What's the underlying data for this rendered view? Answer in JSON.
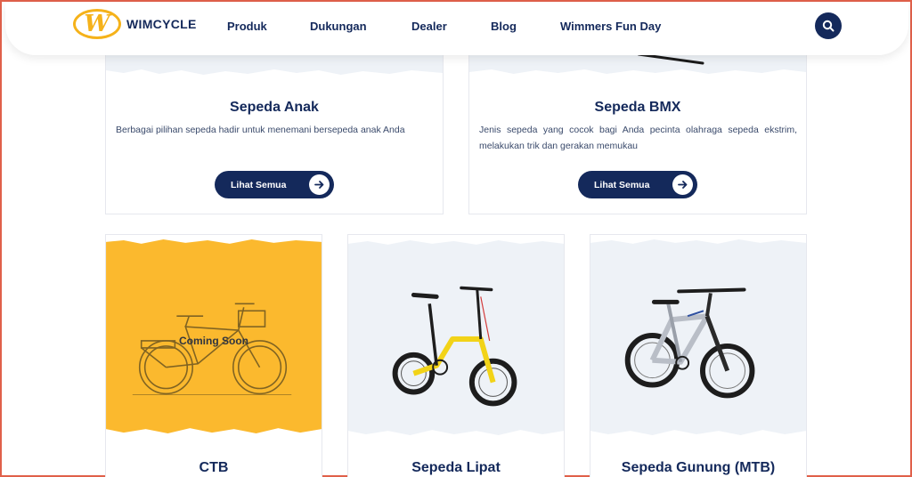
{
  "header": {
    "logo_text": "WIMCYCLE",
    "logo_letter": "W",
    "nav": [
      "Produk",
      "Dukungan",
      "Dealer",
      "Blog",
      "Wimmers Fun Day"
    ]
  },
  "cards_top": [
    {
      "title": "Sepeda Anak",
      "desc": "Berbagai pilihan sepeda hadir untuk menemani bersepeda anak Anda",
      "button": "Lihat Semua"
    },
    {
      "title": "Sepeda BMX",
      "desc": "Jenis sepeda yang cocok bagi Anda pecinta olahraga sepeda ekstrim, melakukan trik dan gerakan memukau",
      "button": "Lihat Semua"
    }
  ],
  "cards_bottom": [
    {
      "title": "CTB",
      "overlay": "Coming Soon"
    },
    {
      "title": "Sepeda Lipat"
    },
    {
      "title": "Sepeda Gunung (MTB)"
    }
  ],
  "colors": {
    "navy": "#14295b",
    "yellow": "#fbb92e",
    "light_bg": "#eef2f7",
    "logo_yellow": "#f5b21a"
  }
}
